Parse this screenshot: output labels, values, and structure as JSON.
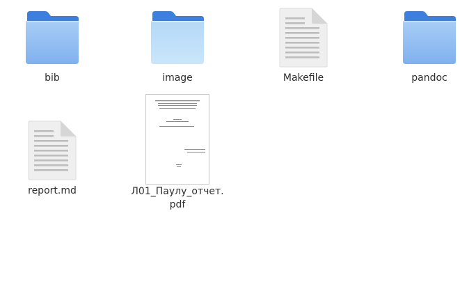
{
  "items": [
    {
      "name": "bib",
      "type": "folder",
      "icon": "folder-icon"
    },
    {
      "name": "image",
      "type": "folder",
      "icon": "folder-icon"
    },
    {
      "name": "Makefile",
      "type": "text-file",
      "icon": "text-file-icon"
    },
    {
      "name": "pandoc",
      "type": "folder",
      "icon": "folder-icon"
    },
    {
      "name": "report.md",
      "type": "text-file",
      "icon": "text-file-icon"
    },
    {
      "name_line1": "Л01_Паулу_отчет.",
      "name_line2": "pdf",
      "type": "pdf",
      "icon": "pdf-thumbnail-icon"
    }
  ],
  "colors": {
    "folder_back": "#3d7fde",
    "folder_front_top": "#a3caf5",
    "folder_front_bottom": "#7fb0ee",
    "doc_page": "#f0f0f0",
    "doc_lines": "#b9b9b9"
  }
}
